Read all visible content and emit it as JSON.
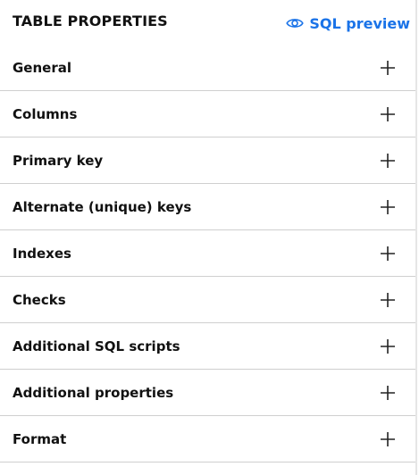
{
  "panel": {
    "title": "TABLE PROPERTIES",
    "preview": {
      "label": "SQL preview",
      "icon": "eye-icon",
      "color": "#1a73e8"
    }
  },
  "sections": [
    {
      "label": "General",
      "icon": "plus-icon",
      "expanded": false
    },
    {
      "label": "Columns",
      "icon": "plus-icon",
      "expanded": false
    },
    {
      "label": "Primary key",
      "icon": "plus-icon",
      "expanded": false
    },
    {
      "label": "Alternate (unique) keys",
      "icon": "plus-icon",
      "expanded": false
    },
    {
      "label": "Indexes",
      "icon": "plus-icon",
      "expanded": false
    },
    {
      "label": "Checks",
      "icon": "plus-icon",
      "expanded": false
    },
    {
      "label": "Additional SQL scripts",
      "icon": "plus-icon",
      "expanded": false
    },
    {
      "label": "Additional properties",
      "icon": "plus-icon",
      "expanded": false
    },
    {
      "label": "Format",
      "icon": "plus-icon",
      "expanded": false
    }
  ]
}
